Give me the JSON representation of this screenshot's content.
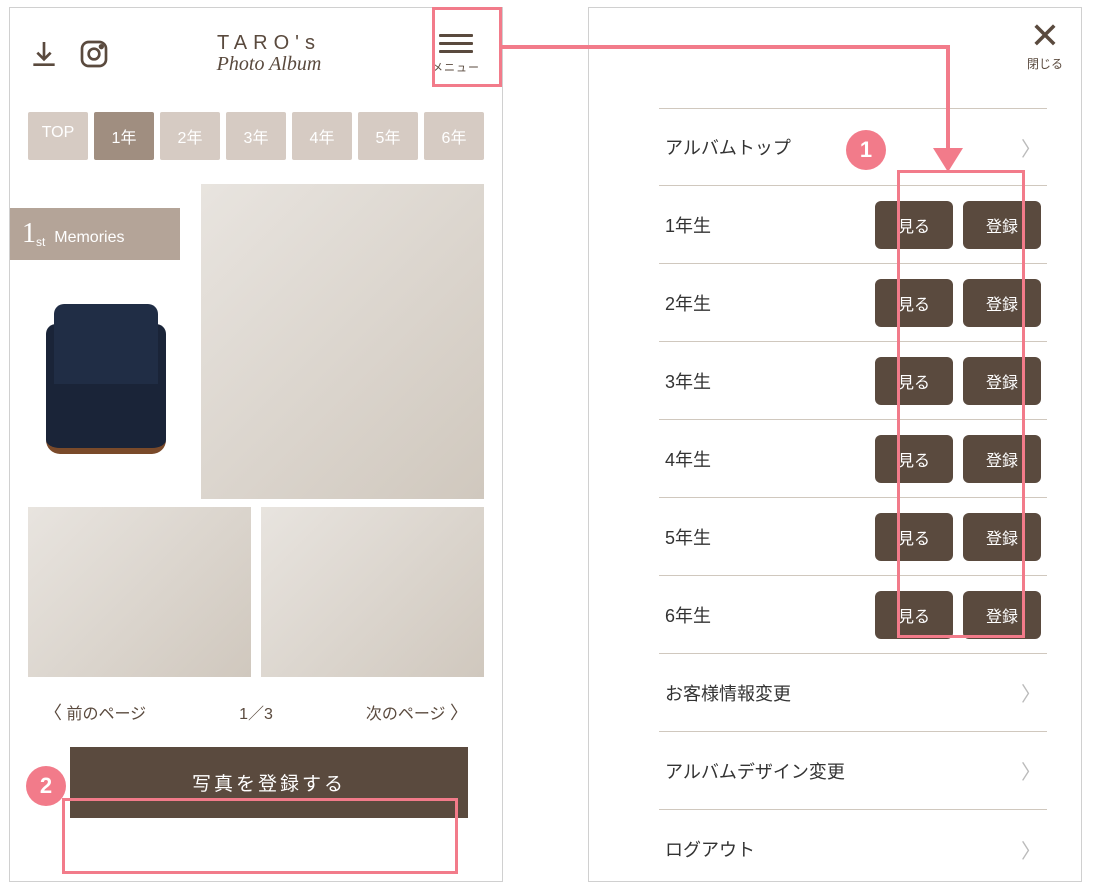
{
  "colors": {
    "accent": "#f27b8a",
    "brown": "#5a4a3e",
    "taupe": "#a08e80",
    "light_taupe": "#d6cbc3"
  },
  "header": {
    "owner": "TARO's",
    "script": "Photo Album",
    "menu_label": "メニュー"
  },
  "tabs": [
    "TOP",
    "1年",
    "2年",
    "3年",
    "4年",
    "5年",
    "6年"
  ],
  "tabs_active_index": 1,
  "memories": {
    "num": "1",
    "suffix": "st",
    "label": "Memories"
  },
  "pager": {
    "prev": "前のページ",
    "indicator": "1／3",
    "next": "次のページ"
  },
  "register_button": "写真を登録する",
  "close_label": "閉じる",
  "menu": {
    "top": "アルバムトップ",
    "grades": [
      {
        "label": "1年生",
        "view": "見る",
        "register": "登録"
      },
      {
        "label": "2年生",
        "view": "見る",
        "register": "登録"
      },
      {
        "label": "3年生",
        "view": "見る",
        "register": "登録"
      },
      {
        "label": "4年生",
        "view": "見る",
        "register": "登録"
      },
      {
        "label": "5年生",
        "view": "見る",
        "register": "登録"
      },
      {
        "label": "6年生",
        "view": "見る",
        "register": "登録"
      }
    ],
    "customer_info": "お客様情報変更",
    "design_change": "アルバムデザイン変更",
    "logout": "ログアウト"
  },
  "callouts": {
    "one": "1",
    "two": "2"
  }
}
